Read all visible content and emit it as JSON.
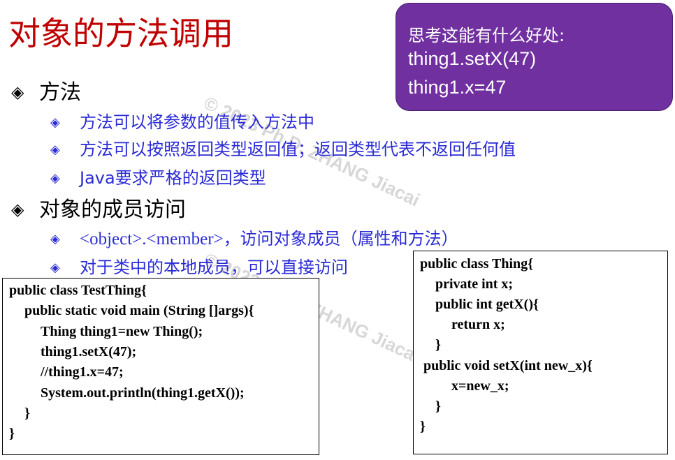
{
  "slide": {
    "title": "对象的方法调用"
  },
  "callout": {
    "line1": "思考这能有什么好处:",
    "line2": "thing1.setX(47)",
    "line3": "thing1.x=47"
  },
  "bullets": {
    "methods": {
      "marker": "◈",
      "label": "方法",
      "items": [
        {
          "marker": "◈",
          "text": "方法可以将参数的值传入方法中"
        },
        {
          "marker": "◈",
          "text": "方法可以按照返回类型返回值；返回类型代表不返回任何值"
        },
        {
          "marker": "◈",
          "text": "Java要求严格的返回类型"
        }
      ]
    },
    "member_access": {
      "marker": "◈",
      "label": "对象的成员访问",
      "items": [
        {
          "marker": "◈",
          "code": "<object>.<member>",
          "text": "，访问对象成员（属性和方法）"
        },
        {
          "marker": "◈",
          "text": "对于类中的本地成员，可以直接访问"
        }
      ]
    }
  },
  "watermarks": [
    "© 2023 Ph.D. ZHANG Jiacai",
    "© 2023 Ph.D. ZHANG Jiacai"
  ],
  "code_test_thing": [
    "public class TestThing{",
    "public static void main (String []args){",
    "Thing thing1=new Thing();",
    "thing1.setX(47);",
    "//thing1.x=47;",
    "System.out.println(thing1.getX());",
    "}",
    "}"
  ],
  "code_thing": [
    "public class Thing{",
    "private int x;",
    "public int getX(){",
    "return x;",
    "}",
    "public void setX(int new_x){",
    "x=new_x;",
    "}",
    "}"
  ]
}
